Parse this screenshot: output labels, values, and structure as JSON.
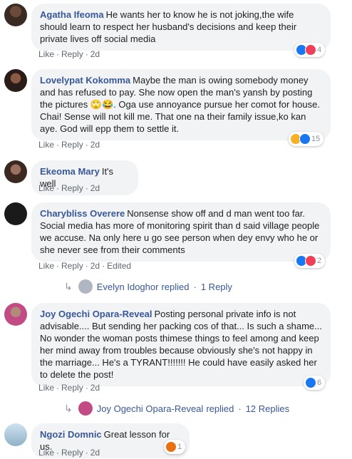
{
  "labels": {
    "like": "Like",
    "reply": "Reply",
    "dot": "·",
    "edited": "Edited"
  },
  "comments": [
    {
      "author": "Agatha Ifeoma",
      "text": "He wants her to know he is not joking,the wife should learn to respect her husband's decisions and keep their private lives off social media",
      "time": "2d",
      "reactions": {
        "icons": [
          "like",
          "love"
        ],
        "count": "4"
      }
    },
    {
      "author": "Lovelypat Kokomma",
      "text": "Maybe the man is owing somebody money and has refused to pay. She now open the man's yansh by posting the pictures 🙄😂. Oga use annoyance pursue her comot for house. Chai! Sense will not kill me. That one na their family issue,ko kan aye. God will epp them to settle it.",
      "time": "2d",
      "reactions": {
        "icons": [
          "haha",
          "like"
        ],
        "count": "15"
      }
    },
    {
      "author": "Ekeoma Mary",
      "text": "It's well",
      "time": "2d"
    },
    {
      "author": "Charybliss Overere",
      "text": "Nonsense show off and d man went too far. Social media has more of monitoring spirit than d said village people we accuse. Na only here u go see person when dey envy who he or she never see from their comments",
      "time": "2d",
      "edited": true,
      "reactions": {
        "icons": [
          "like",
          "love"
        ],
        "count": "2"
      },
      "reply": {
        "name": "Evelyn Idoghor",
        "action": "replied",
        "link": "1 Reply"
      }
    },
    {
      "author": "Joy Ogechi Opara-Reveal",
      "text": "Posting personal private info is not advisable.... But sending her packing cos of that... Is such a shame... No wonder the woman posts thimese things to feel among and keep her mind away from troubles because obviously she's not happy in the marriage... He's a TYRANT!!!!!!! He could have easily asked her to delete the post!",
      "time": "2d",
      "reactions": {
        "icons": [
          "like"
        ],
        "count": "6"
      },
      "reply": {
        "name": "Joy Ogechi Opara-Reveal",
        "action": "replied",
        "link": "12 Replies"
      }
    },
    {
      "author": "Ngozi Domnic",
      "text": "Great lesson for us.",
      "time": "2d",
      "reactions": {
        "icons": [
          "angry"
        ],
        "count": "1"
      }
    }
  ],
  "colors": {
    "link": "#385898",
    "bubble": "#f2f3f5",
    "like": "#1877f2",
    "love": "#f33e58",
    "haha": "#f7b125",
    "angry": "#e9710f"
  }
}
